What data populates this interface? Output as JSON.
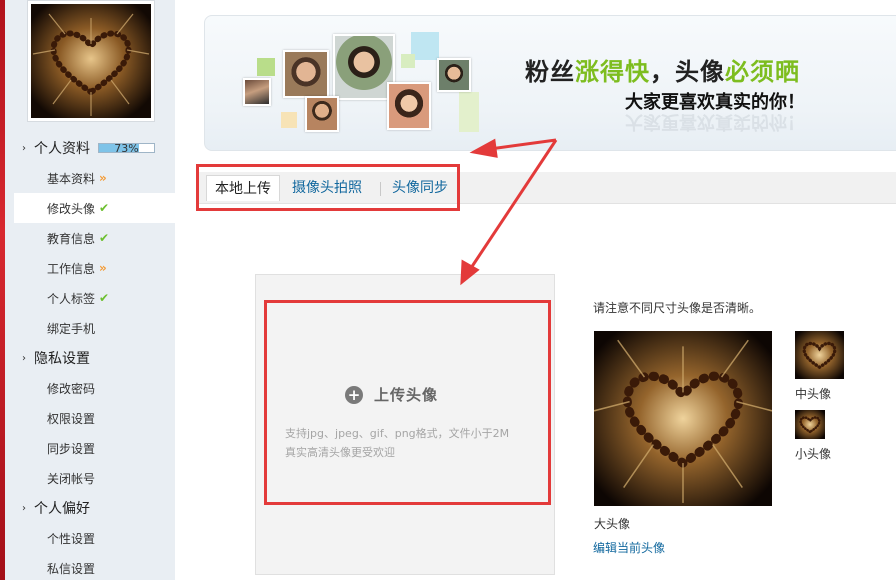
{
  "sidebar": {
    "profile_group": {
      "label": "个人资料",
      "completion_percent": 73,
      "completion_text": "73%"
    },
    "profile_items": [
      {
        "label": "基本资料",
        "status": "incomplete",
        "status_glyph": "»"
      },
      {
        "label": "修改头像",
        "status": "done",
        "status_glyph": "✔",
        "active": true
      },
      {
        "label": "教育信息",
        "status": "done",
        "status_glyph": "✔"
      },
      {
        "label": "工作信息",
        "status": "incomplete",
        "status_glyph": "»"
      },
      {
        "label": "个人标签",
        "status": "done",
        "status_glyph": "✔"
      },
      {
        "label": "绑定手机",
        "status": "none"
      }
    ],
    "privacy_group": {
      "label": "隐私设置"
    },
    "privacy_items": [
      {
        "label": "修改密码"
      },
      {
        "label": "权限设置"
      },
      {
        "label": "同步设置"
      },
      {
        "label": "关闭帐号"
      }
    ],
    "preference_group": {
      "label": "个人偏好"
    },
    "preference_items": [
      {
        "label": "个性设置"
      },
      {
        "label": "私信设置"
      }
    ]
  },
  "banner": {
    "title_part1": "粉丝",
    "title_hl1": "涨得快",
    "title_part2": "，头像",
    "title_hl2": "必须晒",
    "subtitle": "大家更喜欢真实的你！"
  },
  "tabs": [
    {
      "label": "本地上传",
      "active": true
    },
    {
      "label": "摄像头拍照",
      "active": false
    },
    {
      "label": "头像同步",
      "active": false
    }
  ],
  "upload": {
    "button_label": "上传头像",
    "hint_line1": "支持jpg、jpeg、gif、png格式，文件小于2M",
    "hint_line2": "真实高清头像更受欢迎"
  },
  "preview": {
    "note": "请注意不同尺寸头像是否清晰。",
    "large_label": "大头像",
    "medium_label": "中头像",
    "small_label": "小头像",
    "edit_link": "编辑当前头像"
  },
  "colors": {
    "accent_link": "#12689e",
    "highlight_red": "#e33a3a",
    "banner_green": "#7dbd1f",
    "done_green": "#6cbf2e",
    "incomplete_orange": "#f39b36"
  }
}
